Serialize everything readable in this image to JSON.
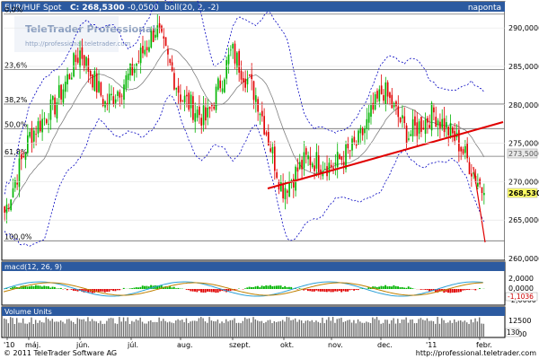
{
  "header": {
    "instrument": "EUR/HUF Spot",
    "close_text": "C: 268,5300",
    "change_text": "-0,0500",
    "indicator_text": "boll(20, 2, -2)",
    "period": "naponta"
  },
  "watermark": {
    "brand": "TeleTrader Professional",
    "url": "http://professional.teletrader.com"
  },
  "price_axis": {
    "ticks": [
      "290,0000",
      "285,0000",
      "280,0000",
      "275,0000",
      "270,0000",
      "265,0000",
      "260,0000"
    ],
    "tick_values": [
      290,
      285,
      280,
      275,
      270,
      265,
      260
    ],
    "range": [
      260,
      292
    ],
    "last_price_label": "268,5300",
    "band_label": "273,5000"
  },
  "fibonacci": [
    {
      "label": "0,0%",
      "value": 291.8
    },
    {
      "label": "23,6%",
      "value": 284.6
    },
    {
      "label": "38,2%",
      "value": 280.1
    },
    {
      "label": "50,0%",
      "value": 276.9
    },
    {
      "label": "61,8%",
      "value": 273.3
    },
    {
      "label": "100,0%",
      "value": 262.3
    }
  ],
  "x_axis": {
    "labels": [
      "'10",
      "máj.",
      "jún.",
      "júl.",
      "aug.",
      "szept.",
      "okt.",
      "nov.",
      "dec.",
      "'11",
      "febr."
    ]
  },
  "macd_panel": {
    "title": "macd(12, 26, 9)",
    "ticks": [
      "2,0000",
      "0,0000",
      "-2,0000"
    ],
    "last_label": "-1,1036"
  },
  "volume_panel": {
    "title": "Volume Units",
    "ticks": [
      "12500",
      "2500"
    ],
    "last_label": "130"
  },
  "footer": {
    "copyright": "© 2011 TeleTrader Software AG",
    "url": "http://professional.teletrader.com"
  },
  "colors": {
    "up": "#00b400",
    "down": "#e00000",
    "trendline": "#e00000",
    "bands": "#0000c0",
    "ma": "#808080",
    "panel_header": "#2c5aa0",
    "label_yellow": "#ffff66"
  },
  "chart_data": {
    "type": "candlestick",
    "instrument": "EUR/HUF Spot",
    "months": [
      "'10",
      "máj.",
      "jún.",
      "júl.",
      "aug.",
      "szept.",
      "okt.",
      "nov.",
      "dec.",
      "'11",
      "febr."
    ],
    "close_path": [
      {
        "x": "'10",
        "y": 266
      },
      {
        "x": "máj.",
        "y": 276
      },
      {
        "x": "máj.",
        "y": 280
      },
      {
        "x": "jún.",
        "y": 287
      },
      {
        "x": "jún.",
        "y": 280
      },
      {
        "x": "júl.",
        "y": 284
      },
      {
        "x": "júl.",
        "y": 290
      },
      {
        "x": "aug.",
        "y": 281
      },
      {
        "x": "aug.",
        "y": 278
      },
      {
        "x": "szept.",
        "y": 287
      },
      {
        "x": "szept.",
        "y": 281
      },
      {
        "x": "okt.",
        "y": 269
      },
      {
        "x": "okt.",
        "y": 273
      },
      {
        "x": "nov.",
        "y": 272
      },
      {
        "x": "nov.",
        "y": 275
      },
      {
        "x": "dec.",
        "y": 282
      },
      {
        "x": "dec.",
        "y": 276
      },
      {
        "x": "'11",
        "y": 279
      },
      {
        "x": "'11",
        "y": 275
      },
      {
        "x": "febr.",
        "y": 268.53
      }
    ],
    "last": 268.53,
    "ylim": [
      260,
      292
    ],
    "grid": true
  }
}
